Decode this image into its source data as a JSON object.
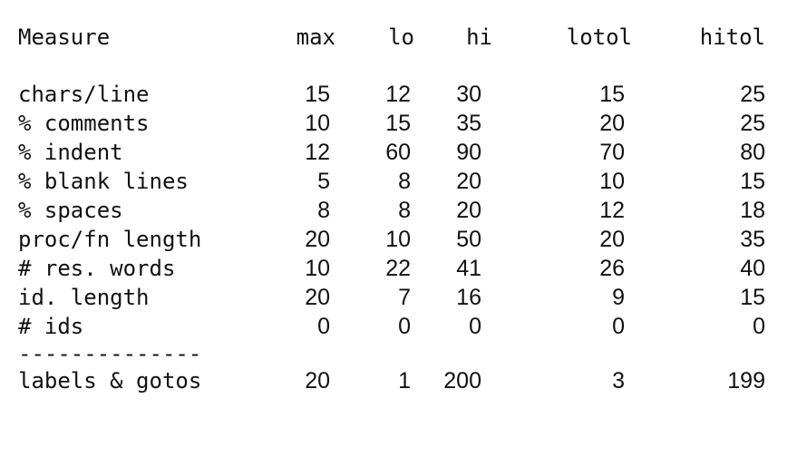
{
  "headers": {
    "measure": "Measure",
    "max": "max",
    "lo": "lo",
    "hi": "hi",
    "lotol": "lotol",
    "hitol": "hitol"
  },
  "rows": [
    {
      "measure": "chars/line",
      "max": "15",
      "lo": "12",
      "hi": "30",
      "lotol": "15",
      "hitol": "25"
    },
    {
      "measure": "% comments",
      "max": "10",
      "lo": "15",
      "hi": "35",
      "lotol": "20",
      "hitol": "25"
    },
    {
      "measure": "% indent",
      "max": "12",
      "lo": "60",
      "hi": "90",
      "lotol": "70",
      "hitol": "80"
    },
    {
      "measure": "% blank lines",
      "max": "5",
      "lo": "8",
      "hi": "20",
      "lotol": "10",
      "hitol": "15"
    },
    {
      "measure": "% spaces",
      "max": "8",
      "lo": "8",
      "hi": "20",
      "lotol": "12",
      "hitol": "18"
    },
    {
      "measure": "proc/fn length",
      "max": "20",
      "lo": "10",
      "hi": "50",
      "lotol": "20",
      "hitol": "35"
    },
    {
      "measure": "# res. words",
      "max": "10",
      "lo": "22",
      "hi": "41",
      "lotol": "26",
      "hitol": "40"
    },
    {
      "measure": "id. length",
      "max": "20",
      "lo": "7",
      "hi": "16",
      "lotol": "9",
      "hitol": "15"
    },
    {
      "measure": "# ids",
      "max": "0",
      "lo": "0",
      "hi": "0",
      "lotol": "0",
      "hitol": "0"
    }
  ],
  "divider": "--------------",
  "footer_row": {
    "measure": "labels & gotos",
    "max": "20",
    "lo": "1",
    "hi": "200",
    "lotol": "3",
    "hitol": "199"
  }
}
